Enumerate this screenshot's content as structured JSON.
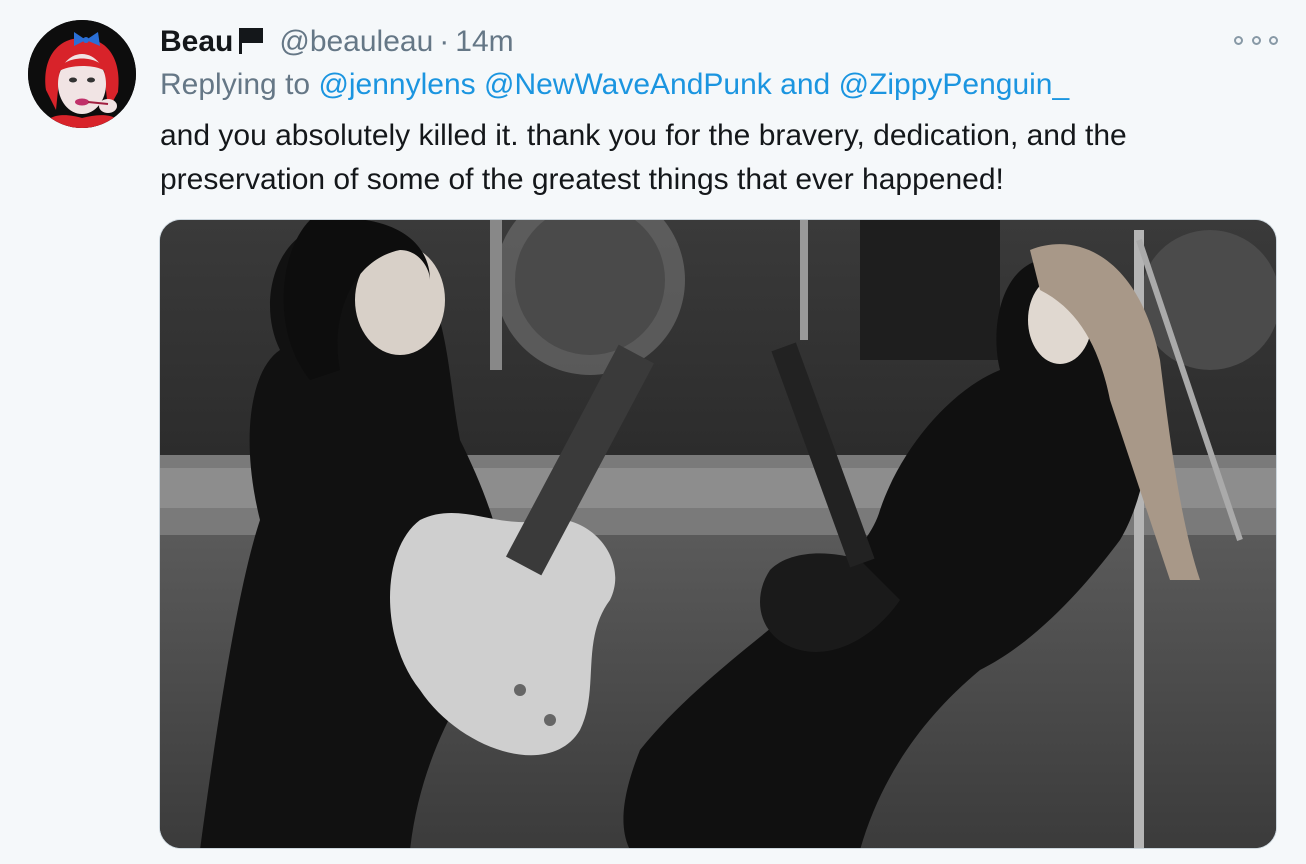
{
  "tweet": {
    "author_name": "Beau",
    "handle": "@beauleau",
    "separator": "·",
    "timestamp": "14m",
    "reply": {
      "prefix": "Replying to",
      "mention1": "@jennylens",
      "mention2": "@NewWaveAndPunk",
      "conjunction": "and",
      "mention3": "@ZippyPenguin_"
    },
    "text": "and you absolutely killed it. thank you for the bravery, dedication, and the preservation of some of the greatest things that ever happened!"
  },
  "icons": {
    "flag": "black-flag-icon",
    "more": "more-options-icon"
  },
  "colors": {
    "background": "#f5f8fa",
    "link": "#1b95e0",
    "secondary_text": "#657786",
    "primary_text": "#14171a"
  }
}
